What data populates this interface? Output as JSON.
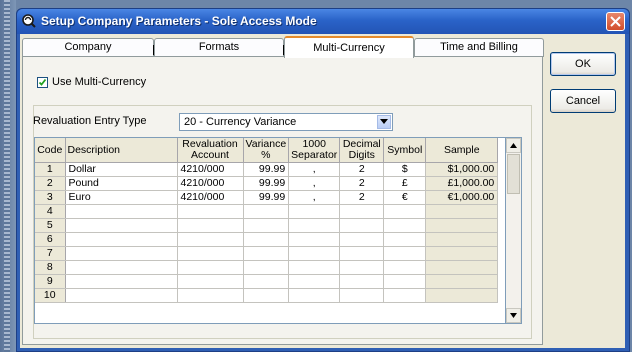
{
  "window": {
    "title": "Setup Company Parameters - Sole Access Mode"
  },
  "tabs": [
    {
      "label": "Company"
    },
    {
      "label": "Formats"
    },
    {
      "label": "Multi-Currency"
    },
    {
      "label": "Time and Billing"
    }
  ],
  "active_tab": "Multi-Currency",
  "use_multi_currency": {
    "label": "Use Multi-Currency",
    "checked": true
  },
  "revaluation": {
    "label": "Revaluation Entry Type",
    "selected": "20 -    Currency Variance"
  },
  "grid": {
    "headers": [
      "Code",
      "Description",
      "Revaluation Account",
      "Variance %",
      "1000 Separator",
      "Decimal Digits",
      "Symbol",
      "Sample"
    ],
    "rows": [
      {
        "code": "1",
        "description": "Dollar",
        "account": "4210/000",
        "variance": "99.99",
        "separator": ",",
        "digits": "2",
        "symbol": "$",
        "sample": "$1,000.00"
      },
      {
        "code": "2",
        "description": "Pound",
        "account": "4210/000",
        "variance": "99.99",
        "separator": ",",
        "digits": "2",
        "symbol": "£",
        "sample": "£1,000.00"
      },
      {
        "code": "3",
        "description": "Euro",
        "account": "4210/000",
        "variance": "99.99",
        "separator": ",",
        "digits": "2",
        "symbol": "€",
        "sample": "€1,000.00"
      },
      {
        "code": "4",
        "description": "",
        "account": "",
        "variance": "",
        "separator": "",
        "digits": "",
        "symbol": "",
        "sample": ""
      },
      {
        "code": "5",
        "description": "",
        "account": "",
        "variance": "",
        "separator": "",
        "digits": "",
        "symbol": "",
        "sample": ""
      },
      {
        "code": "6",
        "description": "",
        "account": "",
        "variance": "",
        "separator": "",
        "digits": "",
        "symbol": "",
        "sample": ""
      },
      {
        "code": "7",
        "description": "",
        "account": "",
        "variance": "",
        "separator": "",
        "digits": "",
        "symbol": "",
        "sample": ""
      },
      {
        "code": "8",
        "description": "",
        "account": "",
        "variance": "",
        "separator": "",
        "digits": "",
        "symbol": "",
        "sample": ""
      },
      {
        "code": "9",
        "description": "",
        "account": "",
        "variance": "",
        "separator": "",
        "digits": "",
        "symbol": "",
        "sample": ""
      },
      {
        "code": "10",
        "description": "",
        "account": "",
        "variance": "",
        "separator": "",
        "digits": "",
        "symbol": "",
        "sample": ""
      }
    ]
  },
  "buttons": {
    "ok": "OK",
    "cancel": "Cancel"
  },
  "icons": {
    "title": "app-logo-icon",
    "close": "close-icon",
    "dropdown": "chevron-down-icon",
    "scroll_up": "scroll-up-arrow-icon",
    "scroll_down": "scroll-down-arrow-icon"
  },
  "colors": {
    "titlebar": "#2a63c8",
    "dialog_bg": "#ece9d8",
    "active_tab_accent": "#e68b2c",
    "close_button": "#d24d2b"
  }
}
